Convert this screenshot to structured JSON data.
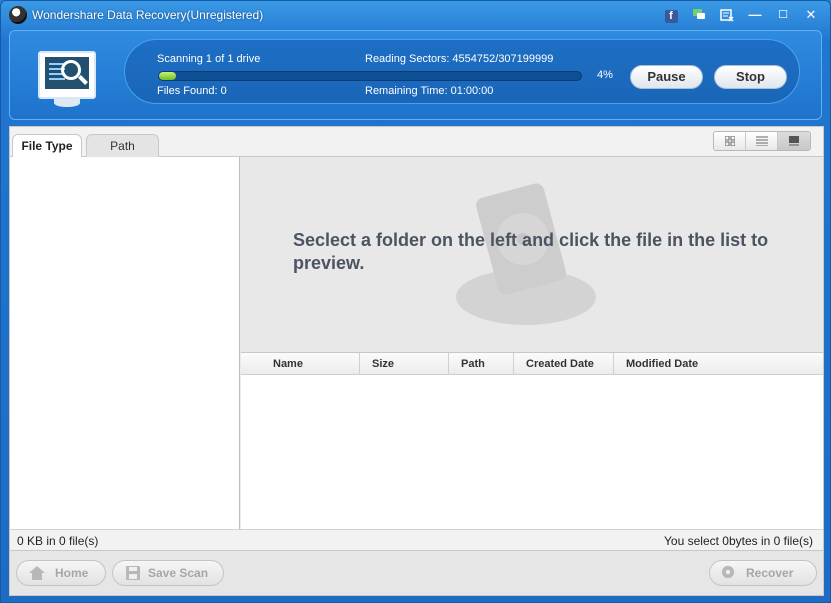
{
  "window": {
    "title": "Wondershare Data Recovery(Unregistered)"
  },
  "titlebar": {
    "facebook": "f",
    "minimize": "—",
    "maximize": "☐",
    "close": "✕"
  },
  "scan": {
    "drive_status": "Scanning 1 of 1 drive",
    "sectors": "Reading Sectors: 4554752/307199999",
    "files_found": "Files Found: 0",
    "remaining": "Remaining Time: 01:00:00",
    "progress_percent": 4,
    "progress_label": "4%",
    "pause_label": "Pause",
    "stop_label": "Stop"
  },
  "tabs": [
    {
      "label": "File Type",
      "active": true
    },
    {
      "label": "Path",
      "active": false
    }
  ],
  "preview": {
    "message": "Seclect a folder on the left and click the file in the list to preview."
  },
  "table": {
    "columns": [
      "Name",
      "Size",
      "Path",
      "Created Date",
      "Modified Date"
    ]
  },
  "status": {
    "left": "0 KB in 0 file(s)",
    "right": "You select 0bytes in 0 file(s)"
  },
  "bottom": {
    "home_label": "Home",
    "save_scan_label": "Save Scan",
    "recover_label": "Recover"
  },
  "colors": {
    "accent": "#1e73cc",
    "progress": "#7cc729"
  }
}
